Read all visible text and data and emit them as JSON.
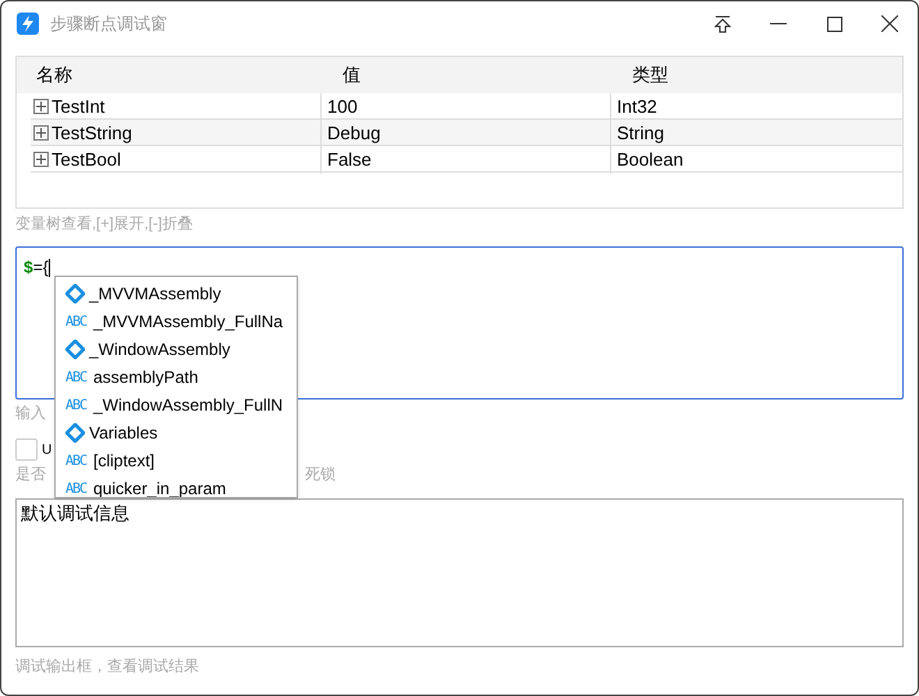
{
  "window": {
    "title": "步骤断点调试窗"
  },
  "table": {
    "columns": [
      "名称",
      "值",
      "类型"
    ],
    "rows": [
      {
        "cells": [
          "TestInt",
          "100",
          "Int32"
        ],
        "expanded": false
      },
      {
        "cells": [
          "TestString",
          "Debug",
          "String"
        ],
        "expanded": false
      },
      {
        "cells": [
          "TestBool",
          "False",
          "Boolean"
        ],
        "expanded": false
      }
    ]
  },
  "table_hint": "变量树查看,[+]展开,[-]折叠",
  "editor": {
    "sigil": "$",
    "text": "={"
  },
  "editor_hint": "输入",
  "checkbox": {
    "label": "U",
    "checked": false
  },
  "checkbox_hint_start": "是否",
  "checkbox_hint_end": "死锁",
  "output": {
    "value": "默认调试信息"
  },
  "output_hint": "调试输出框，查看调试结果",
  "completion": [
    {
      "kind": "member",
      "label": "_MVVMAssembly"
    },
    {
      "kind": "text",
      "badge": "ABC",
      "label": "_MVVMAssembly_FullNa"
    },
    {
      "kind": "member",
      "label": "_WindowAssembly"
    },
    {
      "kind": "text",
      "badge": "ABC",
      "label": "assemblyPath"
    },
    {
      "kind": "text",
      "badge": "ABC",
      "label": "_WindowAssembly_FullN"
    },
    {
      "kind": "member",
      "label": "Variables"
    },
    {
      "kind": "text",
      "badge": "ABC",
      "label": "[cliptext]"
    },
    {
      "kind": "text",
      "badge": "ABC",
      "label": "quicker_in_param"
    }
  ]
}
